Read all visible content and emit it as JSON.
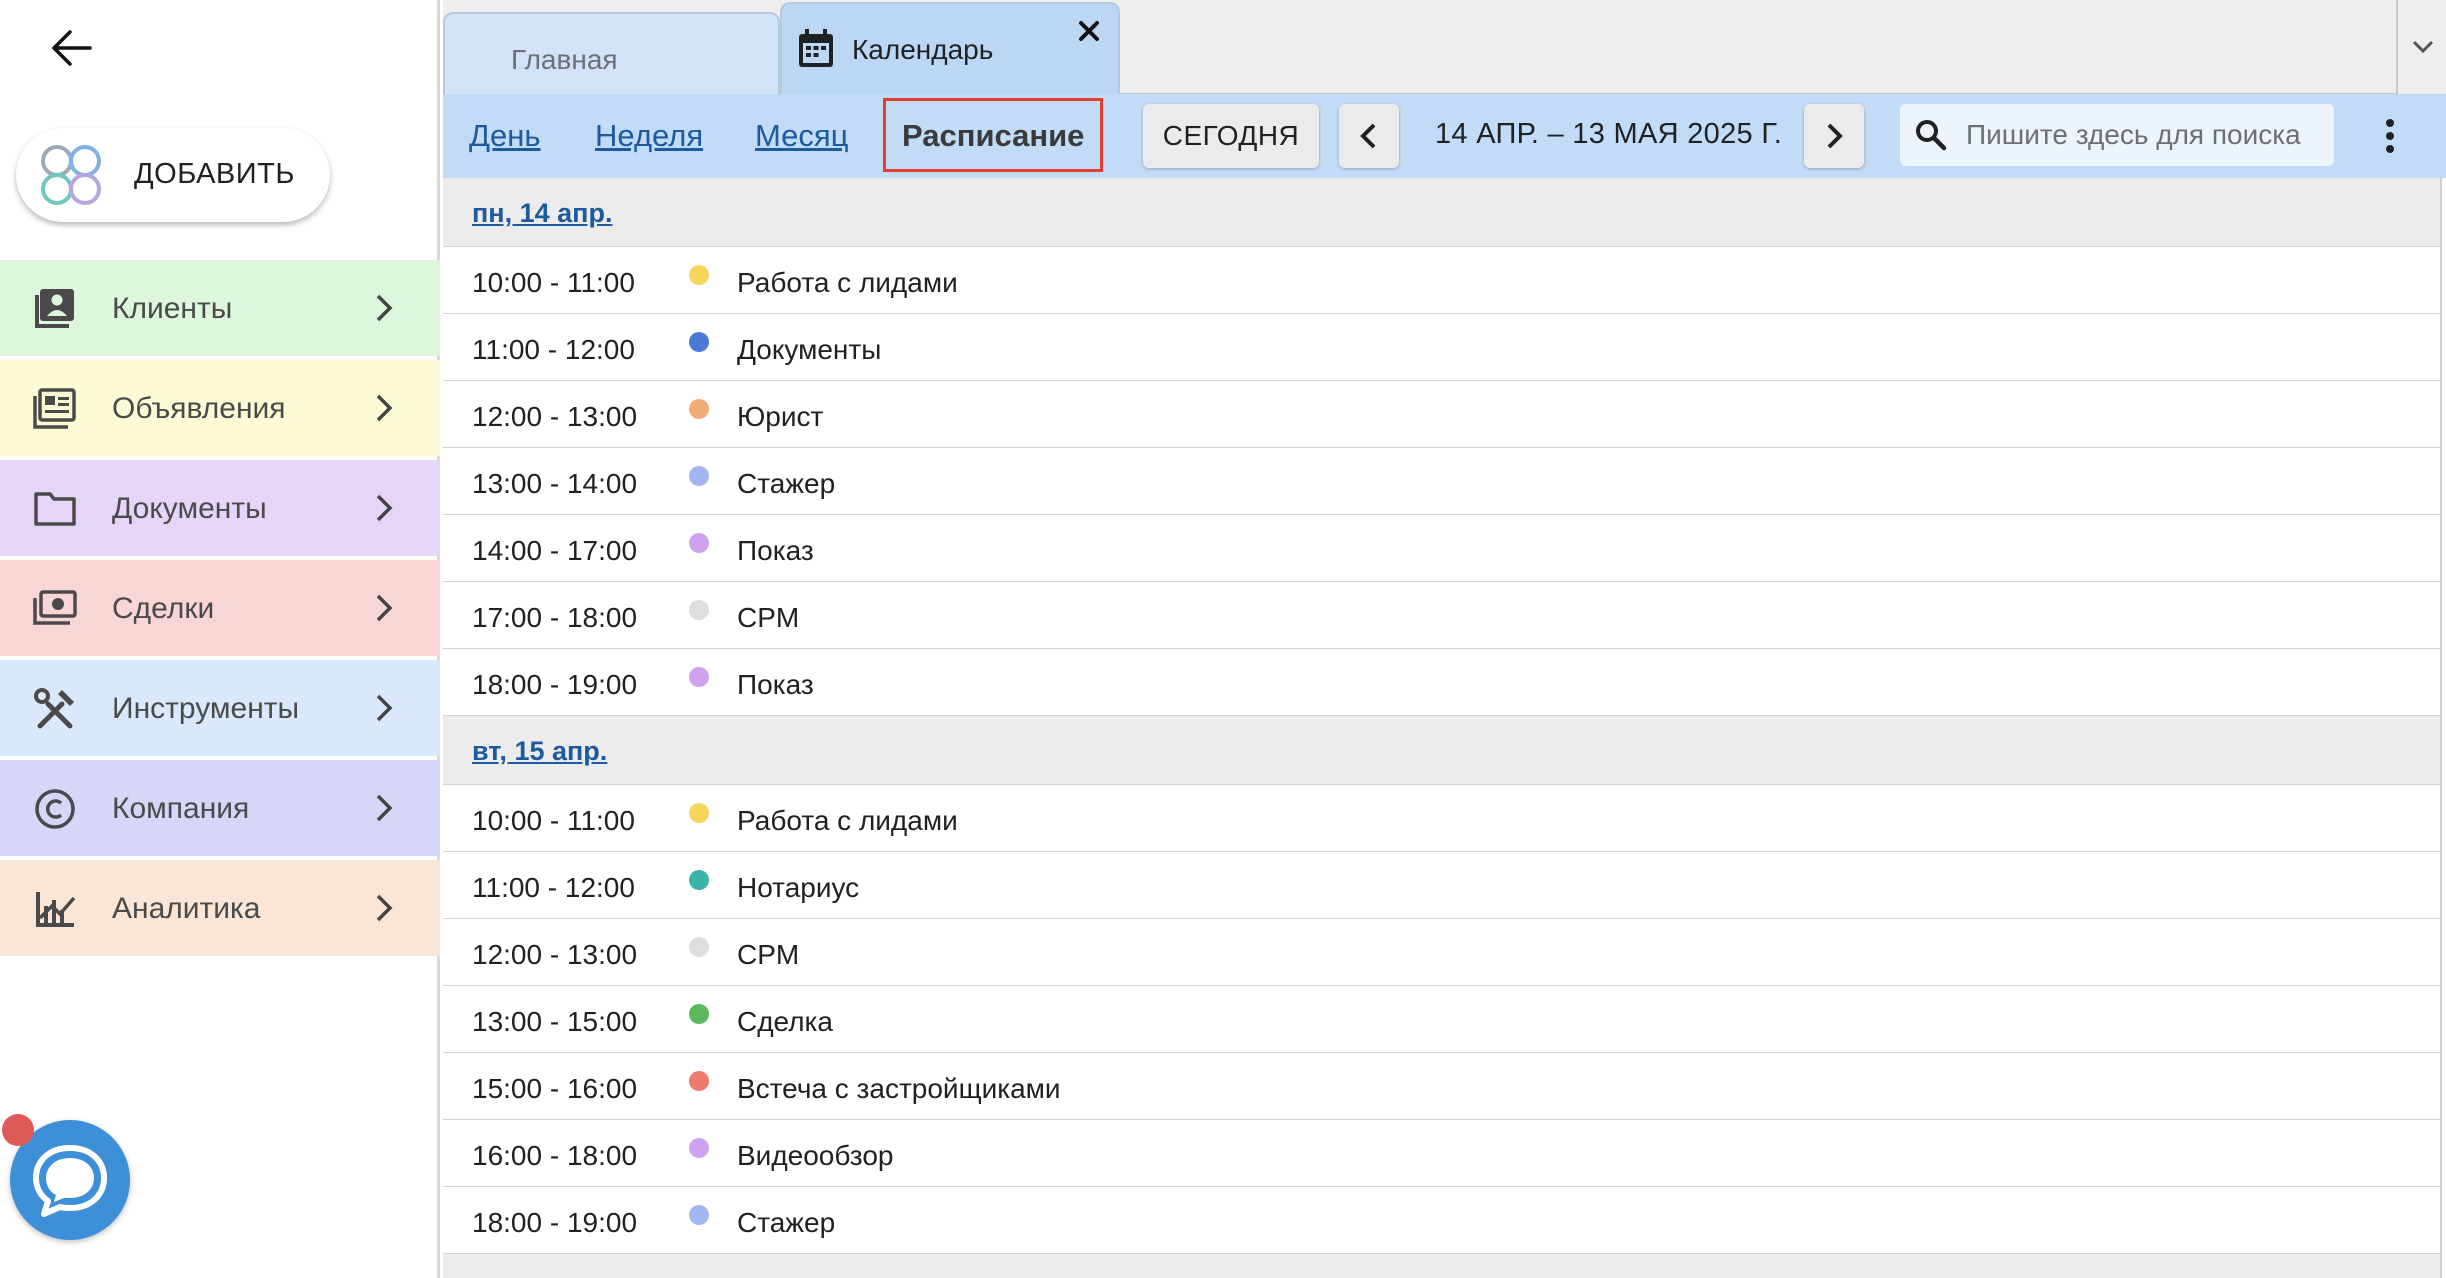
{
  "sidebar": {
    "add_label": "ДОБАВИТЬ",
    "items": [
      {
        "label": "Клиенты",
        "icon": "contacts-icon",
        "bg": "#dcf7dc"
      },
      {
        "label": "Объявления",
        "icon": "listings-icon",
        "bg": "#fdfbd6"
      },
      {
        "label": "Документы",
        "icon": "folder-icon",
        "bg": "#e5d6f8"
      },
      {
        "label": "Сделки",
        "icon": "money-icon",
        "bg": "#f8d6d6"
      },
      {
        "label": "Инструменты",
        "icon": "tools-icon",
        "bg": "#d9e9fb"
      },
      {
        "label": "Компания",
        "icon": "copyright-icon",
        "bg": "#d6d6f8"
      },
      {
        "label": "Аналитика",
        "icon": "analytics-icon",
        "bg": "#fae6d6"
      }
    ]
  },
  "tabs": [
    {
      "label": "Главная"
    },
    {
      "label": "Календарь"
    }
  ],
  "toolbar": {
    "views": [
      "День",
      "Неделя",
      "Месяц",
      "Расписание"
    ],
    "active_view": "Расписание",
    "today_label": "СЕГОДНЯ",
    "range": "14 АПР. – 13 МАЯ 2025 Г.",
    "search_placeholder": "Пишите здесь для поиска"
  },
  "agenda": [
    {
      "day": "пн, 14 апр.",
      "events": [
        {
          "time": "10:00 - 11:00",
          "title": "Работа с лидами",
          "color": "#f6d55c"
        },
        {
          "time": "11:00 - 12:00",
          "title": "Документы",
          "color": "#4a78d8"
        },
        {
          "time": "12:00 - 13:00",
          "title": "Юрист",
          "color": "#f2ad76"
        },
        {
          "time": "13:00 - 14:00",
          "title": "Стажер",
          "color": "#a3b6f0"
        },
        {
          "time": "14:00 - 17:00",
          "title": "Показ",
          "color": "#cfa2f0"
        },
        {
          "time": "17:00 - 18:00",
          "title": "CPM",
          "color": "#dedede"
        },
        {
          "time": "18:00 - 19:00",
          "title": "Показ",
          "color": "#cfa2f0"
        }
      ]
    },
    {
      "day": "вт, 15 апр.",
      "events": [
        {
          "time": "10:00 - 11:00",
          "title": "Работа с лидами",
          "color": "#f6d55c"
        },
        {
          "time": "11:00 - 12:00",
          "title": "Нотариус",
          "color": "#3bb3a8"
        },
        {
          "time": "12:00 - 13:00",
          "title": "CPM",
          "color": "#dedede"
        },
        {
          "time": "13:00 - 15:00",
          "title": "Сделка",
          "color": "#5cb85c"
        },
        {
          "time": "15:00 - 16:00",
          "title": "Встеча с застройщиками",
          "color": "#f07a6e"
        },
        {
          "time": "16:00 - 18:00",
          "title": "Видеообзор",
          "color": "#cfa2f0"
        },
        {
          "time": "18:00 - 19:00",
          "title": "Стажер",
          "color": "#a3b6f0"
        }
      ]
    },
    {
      "day": "",
      "events": []
    }
  ]
}
